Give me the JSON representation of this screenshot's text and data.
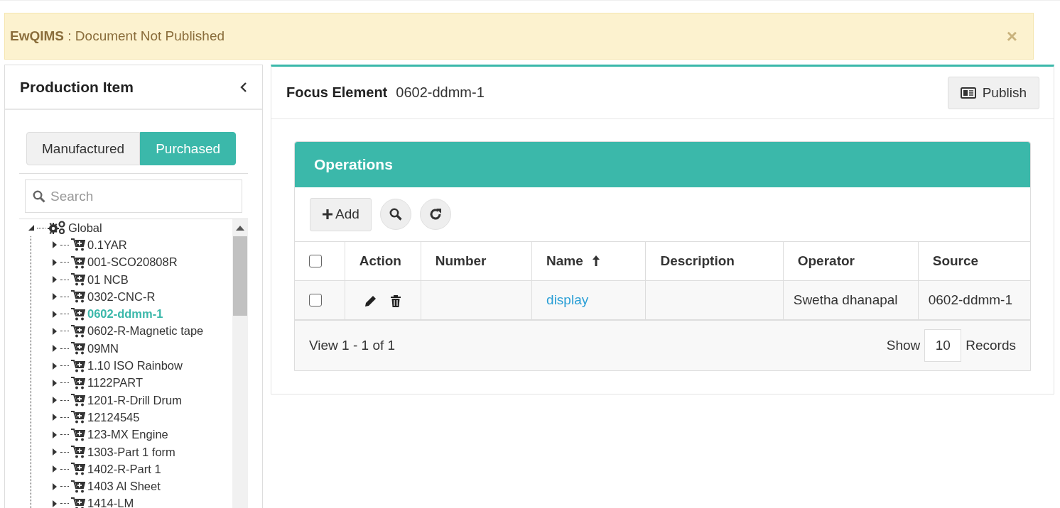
{
  "alert": {
    "message": "**EwQIMS** : Document Not Published",
    "close": "×"
  },
  "sidebar": {
    "title": "Production Item",
    "toggle": [
      {
        "label": "Manufactured",
        "selected": false
      },
      {
        "label": "Purchased",
        "selected": true
      }
    ],
    "search": {
      "placeholder": "Search"
    },
    "tree": [
      {
        "label": "Global",
        "kind": "group",
        "expanded": true,
        "selected": false,
        "children": [
          {
            "label": "0.1YAR",
            "kind": "item",
            "expanded": false,
            "selected": false
          },
          {
            "label": "001-SCO20808R",
            "kind": "item",
            "expanded": false,
            "selected": false
          },
          {
            "label": "01 NCB",
            "kind": "item",
            "expanded": false,
            "selected": false
          },
          {
            "label": "0302-CNC-R",
            "kind": "item",
            "expanded": false,
            "selected": false
          },
          {
            "label": "0602-ddmm-1",
            "kind": "item",
            "expanded": false,
            "selected": true
          },
          {
            "label": "0602-R-Magnetic tape",
            "kind": "item",
            "expanded": false,
            "selected": false
          },
          {
            "label": "09MN",
            "kind": "item",
            "expanded": false,
            "selected": false
          },
          {
            "label": "1.10 ISO Rainbow",
            "kind": "item",
            "expanded": false,
            "selected": false
          },
          {
            "label": "1122PART",
            "kind": "item",
            "expanded": false,
            "selected": false
          },
          {
            "label": "1201-R-Drill Drum",
            "kind": "item",
            "expanded": false,
            "selected": false
          },
          {
            "label": "12124545",
            "kind": "item",
            "expanded": false,
            "selected": false
          },
          {
            "label": "123-MX Engine",
            "kind": "item",
            "expanded": false,
            "selected": false
          },
          {
            "label": "1303-Part 1 form",
            "kind": "item",
            "expanded": false,
            "selected": false
          },
          {
            "label": "1402-R-Part 1",
            "kind": "item",
            "expanded": false,
            "selected": false
          },
          {
            "label": "1403 Al Sheet",
            "kind": "item",
            "expanded": false,
            "selected": false
          },
          {
            "label": "1414-LM",
            "kind": "item",
            "expanded": false,
            "selected": false
          }
        ]
      }
    ]
  },
  "focus": {
    "label": "Focus Element",
    "value": "0602-ddmm-1",
    "publish": "Publish"
  },
  "operations": {
    "title": "Operations",
    "add": "Add",
    "columns": [
      {
        "label": "Action",
        "sorted": false
      },
      {
        "label": "Number",
        "sorted": false
      },
      {
        "label": "Name",
        "sorted": true
      },
      {
        "label": "Description",
        "sorted": false
      },
      {
        "label": "Operator",
        "sorted": false
      },
      {
        "label": "Source",
        "sorted": false
      }
    ],
    "header_checked": false,
    "rows": [
      {
        "checked": false,
        "name": "display",
        "operator": "Swetha dhanapal",
        "source": "0602-ddmm-1"
      }
    ],
    "footer": {
      "view": "View 1 - 1 of 1",
      "show": "Show",
      "page_size": "10",
      "records": "Records"
    }
  }
}
